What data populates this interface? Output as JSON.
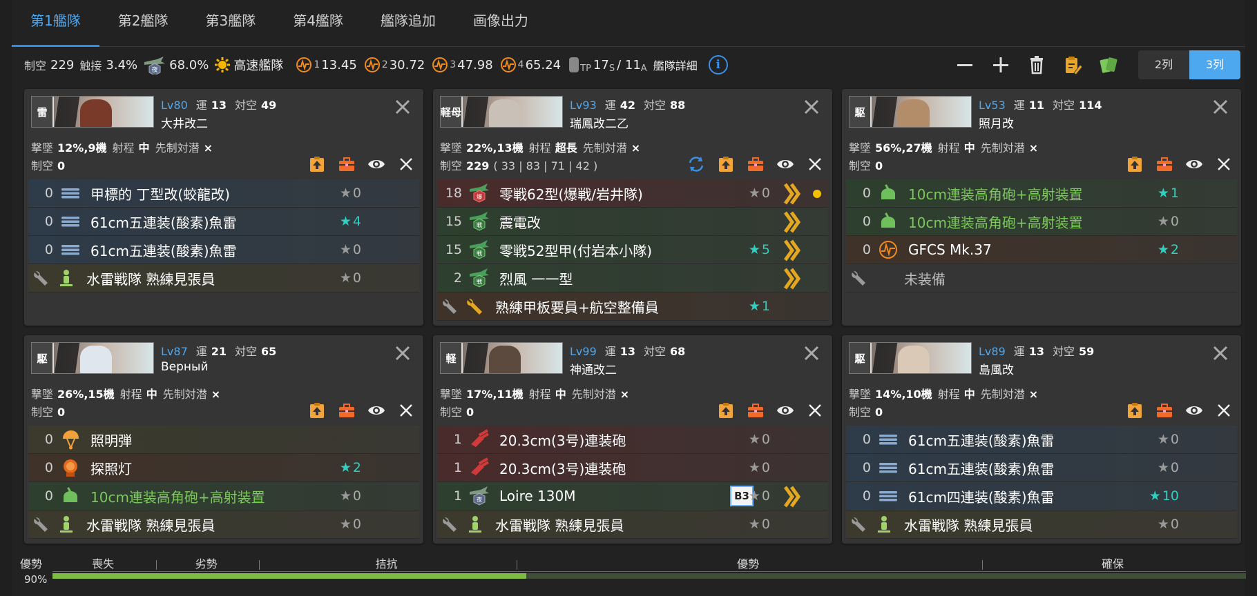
{
  "tabs": [
    "第1艦隊",
    "第2艦隊",
    "第3艦隊",
    "第4艦隊",
    "艦隊追加",
    "画像出力"
  ],
  "summary": {
    "air_label": "制空",
    "air_value": "229",
    "contact_label": "触接",
    "contact_value": "3.4%",
    "night_contact": "68.0%",
    "speed": "高速艦隊",
    "los": [
      {
        "sub": "1",
        "value": "13.45"
      },
      {
        "sub": "2",
        "value": "30.72"
      },
      {
        "sub": "3",
        "value": "47.98"
      },
      {
        "sub": "4",
        "value": "65.24"
      }
    ],
    "tp_label": "TP",
    "tp_s": "17",
    "tp_s_sub": "S",
    "tp_a": "/ 11",
    "tp_a_sub": "A",
    "detail": "艦隊詳細",
    "info": "i"
  },
  "columns": {
    "two": "2列",
    "three": "3列"
  },
  "labels": {
    "lv": "Lv",
    "luck": "運",
    "aa": "対空",
    "shootdown": "撃墜",
    "range": "射程",
    "oasw": "先制対潜",
    "air": "制空"
  },
  "ships": [
    {
      "badge": "雷",
      "lv": "80",
      "luck": "13",
      "aa": "49",
      "name": "大井改二",
      "shootdown": "12%,9機",
      "range": "中",
      "oasw": "×",
      "air": "0",
      "air_slots": "",
      "banner_color": "#7a3a2a",
      "equips": [
        {
          "count": "0",
          "icon": "torpedo",
          "name": "甲標的 丁型改(蛟龍改)",
          "star": "0",
          "teal": false,
          "bg": "blue"
        },
        {
          "count": "0",
          "icon": "torpedo",
          "name": "61cm五連装(酸素)魚雷",
          "star": "4",
          "teal": true,
          "bg": "blue"
        },
        {
          "count": "0",
          "icon": "torpedo",
          "name": "61cm五連装(酸素)魚雷",
          "star": "0",
          "teal": false,
          "bg": "blue"
        },
        {
          "count": "",
          "icon": "lookout",
          "name": "水雷戦隊 熟練見張員",
          "star": "0",
          "teal": false,
          "bg": "olive",
          "ex": true
        }
      ]
    },
    {
      "badge": "軽母",
      "lv": "93",
      "luck": "42",
      "aa": "88",
      "name": "瑞鳳改二乙",
      "shootdown": "22%,13機",
      "range": "超長",
      "oasw": "×",
      "air": "229",
      "air_slots": "( 33 | 83 | 71 | 42 )",
      "banner_color": "#c9c0b8",
      "equips": [
        {
          "count": "18",
          "icon": "bomber",
          "name": "零戦62型(爆戦/岩井隊)",
          "star": "0",
          "teal": false,
          "bg": "red",
          "prof": true,
          "dot": true
        },
        {
          "count": "15",
          "icon": "fighter",
          "name": "震電改",
          "star": "",
          "teal": false,
          "bg": "green",
          "prof": true
        },
        {
          "count": "15",
          "icon": "fighter",
          "name": "零戦52型甲(付岩本小隊)",
          "star": "5",
          "teal": true,
          "bg": "green",
          "prof": true
        },
        {
          "count": "2",
          "icon": "fighter",
          "name": "烈風 一一型",
          "star": "",
          "teal": false,
          "bg": "green",
          "prof": true
        },
        {
          "count": "",
          "icon": "mechanic",
          "name": "熟練甲板要員+航空整備員",
          "star": "1",
          "teal": true,
          "bg": "brown",
          "ex": true
        }
      ]
    },
    {
      "badge": "駆",
      "lv": "53",
      "luck": "11",
      "aa": "114",
      "name": "照月改",
      "shootdown": "56%,27機",
      "range": "中",
      "oasw": "×",
      "air": "0",
      "air_slots": "",
      "banner_color": "#b38d6a",
      "equips": [
        {
          "count": "0",
          "icon": "hagun",
          "name": "10cm連装高角砲+高射装置",
          "star": "1",
          "teal": true,
          "bg": "green",
          "green": true
        },
        {
          "count": "0",
          "icon": "hagun",
          "name": "10cm連装高角砲+高射装置",
          "star": "0",
          "teal": false,
          "bg": "green",
          "green": true
        },
        {
          "count": "0",
          "icon": "radar",
          "name": "GFCS Mk.37",
          "star": "2",
          "teal": true,
          "bg": "brown"
        },
        {
          "count": "",
          "icon": "none",
          "name": "未装備",
          "star": "",
          "teal": false,
          "bg": "plain",
          "ex": true,
          "grey": true
        }
      ]
    },
    {
      "badge": "駆",
      "lv": "87",
      "luck": "21",
      "aa": "65",
      "name": "Верный",
      "shootdown": "26%,15機",
      "range": "中",
      "oasw": "×",
      "air": "0",
      "air_slots": "",
      "banner_color": "#dfe6ee",
      "equips": [
        {
          "count": "0",
          "icon": "flare",
          "name": "照明弾",
          "star": "",
          "teal": false,
          "bg": "olive"
        },
        {
          "count": "0",
          "icon": "searchlight",
          "name": "探照灯",
          "star": "2",
          "teal": true,
          "bg": "brown"
        },
        {
          "count": "0",
          "icon": "hagun",
          "name": "10cm連装高角砲+高射装置",
          "star": "0",
          "teal": false,
          "bg": "green",
          "green": true
        },
        {
          "count": "",
          "icon": "lookout",
          "name": "水雷戦隊 熟練見張員",
          "star": "0",
          "teal": false,
          "bg": "olive",
          "ex": true
        }
      ]
    },
    {
      "badge": "軽",
      "lv": "99",
      "luck": "13",
      "aa": "68",
      "name": "神通改二",
      "shootdown": "17%,11機",
      "range": "中",
      "oasw": "×",
      "air": "0",
      "air_slots": "",
      "banner_color": "#5c4a3e",
      "equips": [
        {
          "count": "1",
          "icon": "maingun",
          "name": "20.3cm(3号)連装砲",
          "star": "0",
          "teal": false,
          "bg": "red"
        },
        {
          "count": "1",
          "icon": "maingun",
          "name": "20.3cm(3号)連装砲",
          "star": "0",
          "teal": false,
          "bg": "red"
        },
        {
          "count": "1",
          "icon": "seaplane",
          "name": "Loire 130M",
          "star": "0",
          "teal": false,
          "bg": "green",
          "prof": true,
          "b3": "B3"
        },
        {
          "count": "",
          "icon": "lookout",
          "name": "水雷戦隊 熟練見張員",
          "star": "0",
          "teal": false,
          "bg": "olive",
          "ex": true
        }
      ]
    },
    {
      "badge": "駆",
      "lv": "89",
      "luck": "13",
      "aa": "59",
      "name": "島風改",
      "shootdown": "14%,10機",
      "range": "中",
      "oasw": "×",
      "air": "0",
      "air_slots": "",
      "banner_color": "#d9c9b6",
      "equips": [
        {
          "count": "0",
          "icon": "torpedo",
          "name": "61cm五連装(酸素)魚雷",
          "star": "0",
          "teal": false,
          "bg": "blue"
        },
        {
          "count": "0",
          "icon": "torpedo",
          "name": "61cm五連装(酸素)魚雷",
          "star": "0",
          "teal": false,
          "bg": "blue"
        },
        {
          "count": "0",
          "icon": "torpedo",
          "name": "61cm四連装(酸素)魚雷",
          "star": "10",
          "teal": true,
          "bg": "blue"
        },
        {
          "count": "",
          "icon": "lookout",
          "name": "水雷戦隊 熟練見張員",
          "star": "0",
          "teal": false,
          "bg": "olive",
          "ex": true
        }
      ]
    }
  ],
  "air_bar": {
    "label": "優勢",
    "percent": "90%",
    "fill_fraction": 0.397,
    "segments": [
      {
        "label": "喪失",
        "at": 0.0,
        "end": 0.087
      },
      {
        "label": "劣勢",
        "at": 0.087,
        "end": 0.173
      },
      {
        "label": "拮抗",
        "at": 0.173,
        "end": 0.389
      },
      {
        "label": "優勢",
        "at": 0.389,
        "end": 0.779
      },
      {
        "label": "確保",
        "at": 0.779,
        "end": 1.0
      }
    ]
  },
  "colors": {
    "accent": "#4ea8f0",
    "star_teal": "#2fd0c0",
    "green_text": "#7cc85c",
    "orange_icon": "#f28a1e",
    "prof_gold": "#e3a722",
    "fill_green": "#7dbb42"
  }
}
